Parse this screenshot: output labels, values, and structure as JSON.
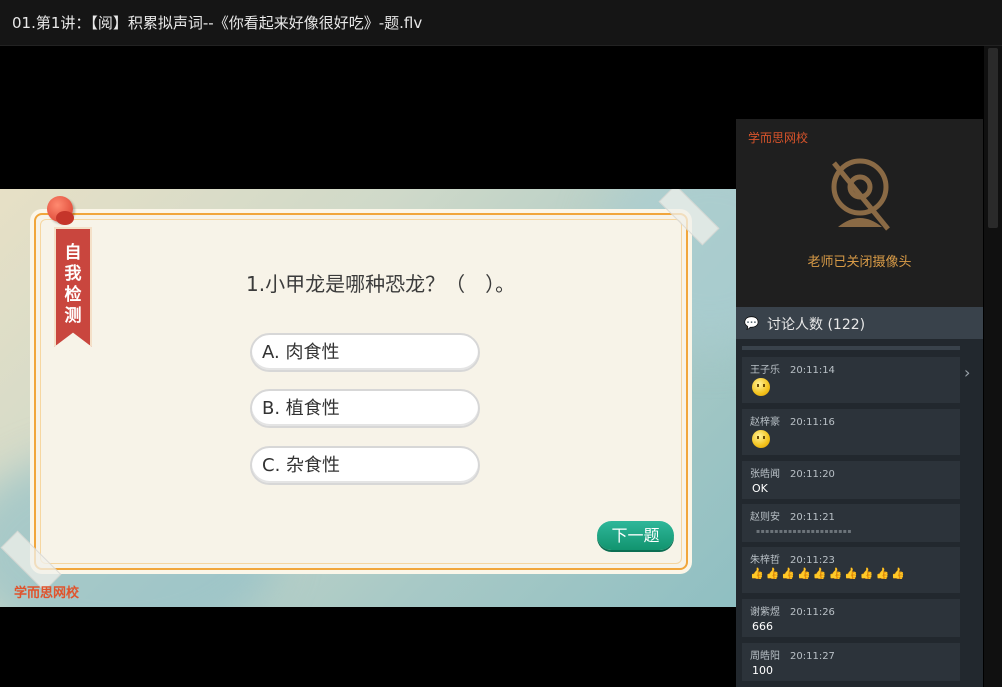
{
  "window": {
    "title": "01.第1讲：【阅】积累拟声词--《你看起来好像很好吃》-题.flv"
  },
  "slide": {
    "banner_chars": [
      "自",
      "我",
      "检",
      "测"
    ],
    "question": "1.小甲龙是哪种恐龙？（　）。",
    "options": [
      "A. 肉食性",
      "B. 植食性",
      "C. 杂食性"
    ],
    "next_label": "下一题",
    "logo": "学而思网校"
  },
  "camera": {
    "logo": "学而思网校",
    "status": "老师已关闭摄像头",
    "icon": "camera-off-icon"
  },
  "chat": {
    "header": "讨论人数",
    "count": "(122)",
    "messages": [
      {
        "name": "王子乐",
        "time": "20:11:14",
        "text": "",
        "type": "emoji"
      },
      {
        "name": "赵梓豪",
        "time": "20:11:16",
        "text": "",
        "type": "emoji"
      },
      {
        "name": "张皓闻",
        "time": "20:11:20",
        "text": "OK",
        "type": "text"
      },
      {
        "name": "赵则安",
        "time": "20:11:21",
        "text": "",
        "type": "blurred"
      },
      {
        "name": "朱梓哲",
        "time": "20:11:23",
        "text": "👍👍👍👍👍👍👍👍👍👍",
        "type": "thumbs"
      },
      {
        "name": "谢紫煜",
        "time": "20:11:26",
        "text": "666",
        "type": "text"
      },
      {
        "name": "周皓阳",
        "time": "20:11:27",
        "text": "100",
        "type": "text"
      }
    ]
  },
  "colors": {
    "card_border": "#f1a63b",
    "banner": "#c9463e",
    "next_button": "#12946f",
    "logo": "#d8542b",
    "camera_text": "#d89b47",
    "chat_bg": "#22282e"
  }
}
